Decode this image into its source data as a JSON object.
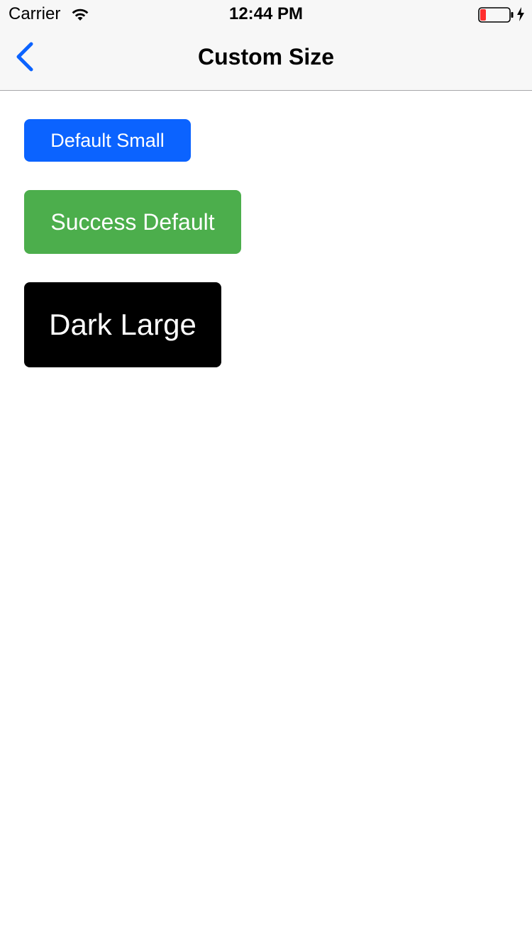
{
  "status_bar": {
    "carrier": "Carrier",
    "time": "12:44 PM",
    "icons": [
      "wifi-icon",
      "battery-icon",
      "charging-icon"
    ],
    "battery_level": 0.2
  },
  "nav": {
    "back_icon": "chevron-left-icon",
    "title": "Custom Size"
  },
  "buttons": [
    {
      "label": "Default Small",
      "color": "#0b63ff"
    },
    {
      "label": "Success Default",
      "color": "#4cae4c"
    },
    {
      "label": "Dark Large",
      "color": "#000000"
    }
  ],
  "colors": {
    "accent": "#0b63ff",
    "bar_background": "#f7f7f7",
    "battery_low": "#ff2d2d"
  }
}
